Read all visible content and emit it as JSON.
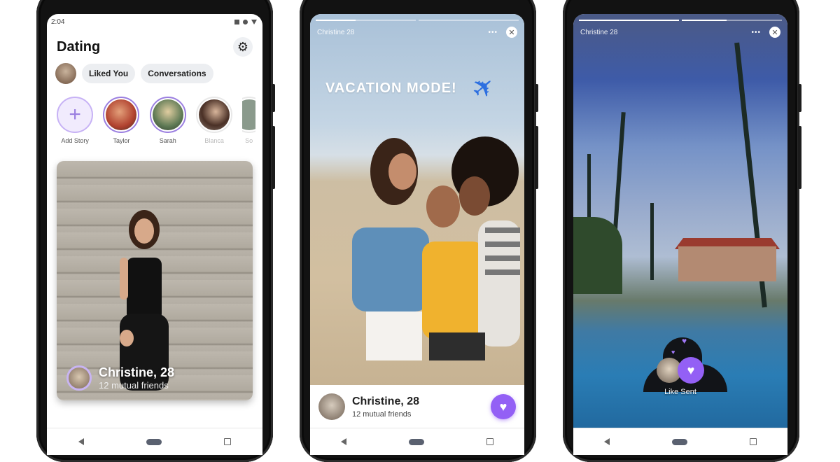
{
  "phone1": {
    "status_time": "2:04",
    "title": "Dating",
    "chips": [
      "Liked You",
      "Conversations"
    ],
    "stories": [
      {
        "label": "Add Story",
        "type": "add"
      },
      {
        "label": "Taylor",
        "type": "ring"
      },
      {
        "label": "Sarah",
        "type": "ring"
      },
      {
        "label": "Blanca",
        "type": "seen"
      },
      {
        "label": "So",
        "type": "seen"
      }
    ],
    "card": {
      "name": "Christine, 28",
      "subtitle": "12 mutual friends"
    }
  },
  "phone2": {
    "story_owner": "Christine 28",
    "progress": [
      0.4,
      0.0
    ],
    "overlay_text": "VACATION MODE!",
    "overlay_emoji": "✈",
    "card": {
      "name": "Christine, 28",
      "subtitle": "12 mutual friends"
    }
  },
  "phone3": {
    "story_owner": "Christine 28",
    "progress": [
      1.0,
      0.45
    ],
    "like_sent_label": "Like Sent"
  },
  "icons": {
    "gear": "⚙",
    "plus": "+",
    "close": "✕",
    "more": "•••",
    "heart": "♥"
  },
  "colors": {
    "accent": "#9360f5",
    "ring": "#9b7fe0"
  }
}
